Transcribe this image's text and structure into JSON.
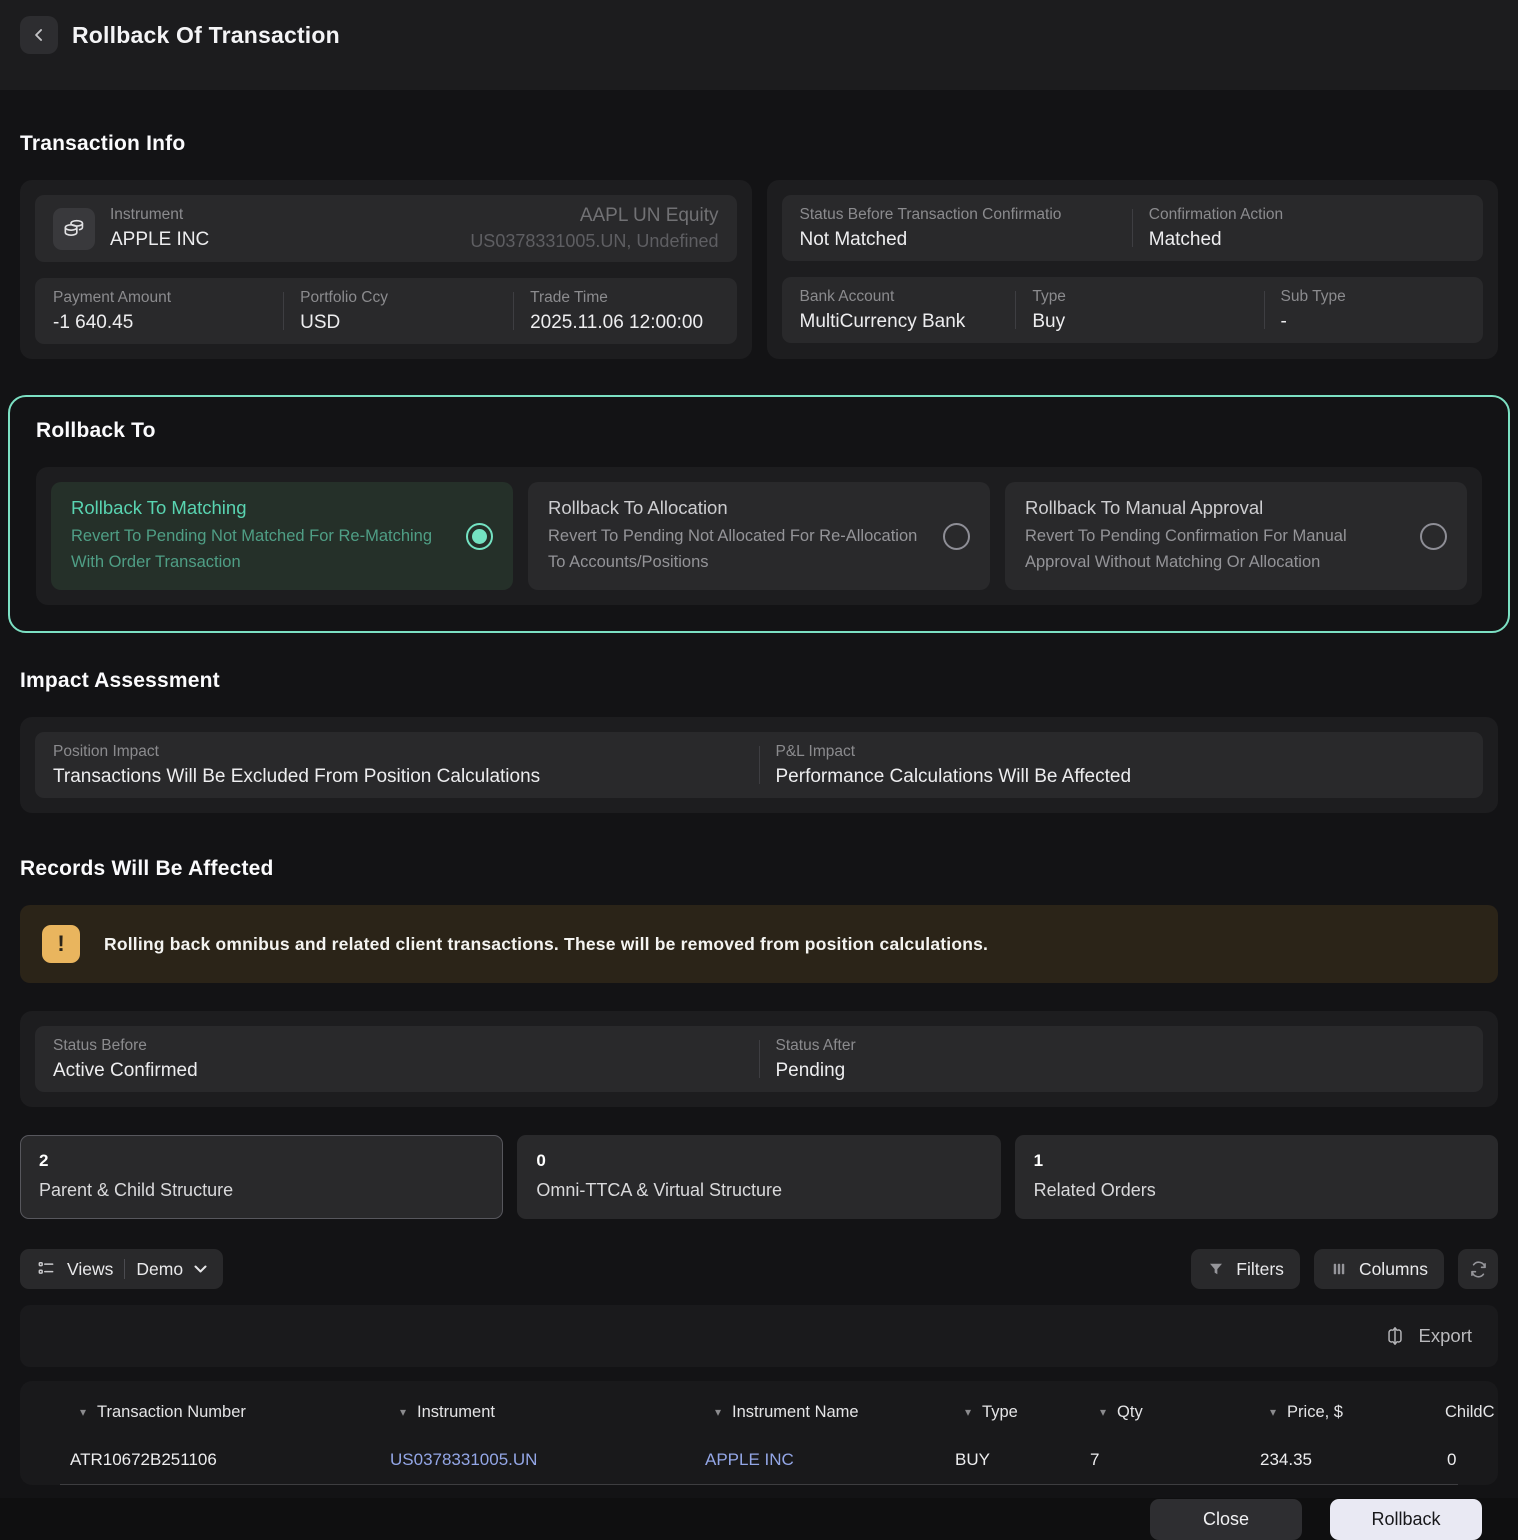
{
  "header": {
    "title": "Rollback Of Transaction"
  },
  "transaction_info": {
    "heading": "Transaction Info",
    "instrument": {
      "label": "Instrument",
      "value": "APPLE INC",
      "right_primary": "AAPL UN Equity",
      "right_secondary": "US0378331005.UN, Undefined"
    },
    "payment_amount": {
      "label": "Payment Amount",
      "value": "-1 640.45"
    },
    "portfolio_ccy": {
      "label": "Portfolio Ccy",
      "value": "USD"
    },
    "trade_time": {
      "label": "Trade Time",
      "value": "2025.11.06 12:00:00"
    },
    "status_before_confirmation": {
      "label": "Status Before Transaction Confirmatio",
      "value": "Not Matched"
    },
    "confirmation_action": {
      "label": "Confirmation Action",
      "value": "Matched"
    },
    "bank_account": {
      "label": "Bank Account",
      "value": "MultiCurrency Bank"
    },
    "type": {
      "label": "Type",
      "value": "Buy"
    },
    "sub_type": {
      "label": "Sub Type",
      "value": "-"
    }
  },
  "rollback_to": {
    "heading": "Rollback To",
    "options": [
      {
        "title": "Rollback To Matching",
        "description": "Revert To Pending Not Matched For Re-Matching With Order Transaction",
        "selected": true
      },
      {
        "title": "Rollback To Allocation",
        "description": "Revert To Pending Not Allocated For Re-Allocation To Accounts/Positions",
        "selected": false
      },
      {
        "title": "Rollback To Manual Approval",
        "description": "Revert To Pending Confirmation For Manual Approval Without Matching Or Allocation",
        "selected": false
      }
    ]
  },
  "impact_assessment": {
    "heading": "Impact Assessment",
    "position_impact": {
      "label": "Position Impact",
      "value": "Transactions Will Be Excluded From Position Calculations"
    },
    "pnl_impact": {
      "label": "P&L Impact",
      "value": "Performance Calculations Will Be Affected"
    }
  },
  "records_affected": {
    "heading": "Records Will Be Affected",
    "warning_text": "Rolling back omnibus and related client transactions. These will be removed from position calculations.",
    "status_before": {
      "label": "Status Before",
      "value": "Active Confirmed"
    },
    "status_after": {
      "label": "Status After",
      "value": "Pending"
    },
    "stats": [
      {
        "value": "2",
        "label": "Parent & Child Structure",
        "selected": true
      },
      {
        "value": "0",
        "label": "Omni-TTCA & Virtual Structure",
        "selected": false
      },
      {
        "value": "1",
        "label": "Related Orders",
        "selected": false
      }
    ]
  },
  "toolbar": {
    "views_label": "Views",
    "views_value": "Demo",
    "filters_label": "Filters",
    "columns_label": "Columns",
    "export_label": "Export"
  },
  "table": {
    "columns": [
      "Transaction Number",
      "Instrument",
      "Instrument Name",
      "Type",
      "Qty",
      "Price, $",
      "ChildC"
    ],
    "rows": [
      {
        "transaction_number": "ATR10672B251106",
        "instrument": "US0378331005.UN",
        "instrument_name": "APPLE INC",
        "type": "BUY",
        "qty": "7",
        "price": "234.35",
        "child_count": "0"
      }
    ]
  },
  "footer": {
    "close_label": "Close",
    "rollback_label": "Rollback"
  },
  "icons": {
    "back": "chevron-left",
    "instrument": "coins",
    "warning": "exclamation",
    "views": "list",
    "caret": "caret-down",
    "filters": "funnel",
    "columns": "columns",
    "refresh": "refresh",
    "export": "export-arrows",
    "sort": "caret-down"
  },
  "colors": {
    "accent_teal": "#7ce0c3",
    "link_blue": "#93a6e6",
    "warning_amber": "#e9b55e"
  }
}
